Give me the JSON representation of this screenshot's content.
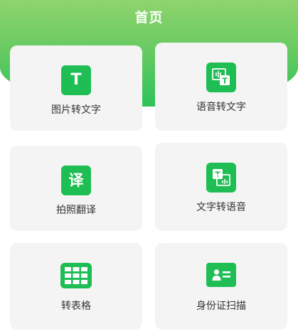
{
  "header": {
    "title": "首页"
  },
  "tools": [
    {
      "label": "图片转文字",
      "icon_text": "T"
    },
    {
      "label": "语音转文字",
      "icon_text": "T"
    },
    {
      "label": "拍照翻译",
      "icon_text": "译"
    },
    {
      "label": "文字转语音",
      "icon_text": "T"
    },
    {
      "label": "转表格"
    },
    {
      "label": "身份证扫描"
    }
  ],
  "colors": {
    "header_top": "#8fd46e",
    "header_bottom": "#2fc25b",
    "icon_green": "#1fbe55",
    "card_bg": "#f4f4f4"
  }
}
